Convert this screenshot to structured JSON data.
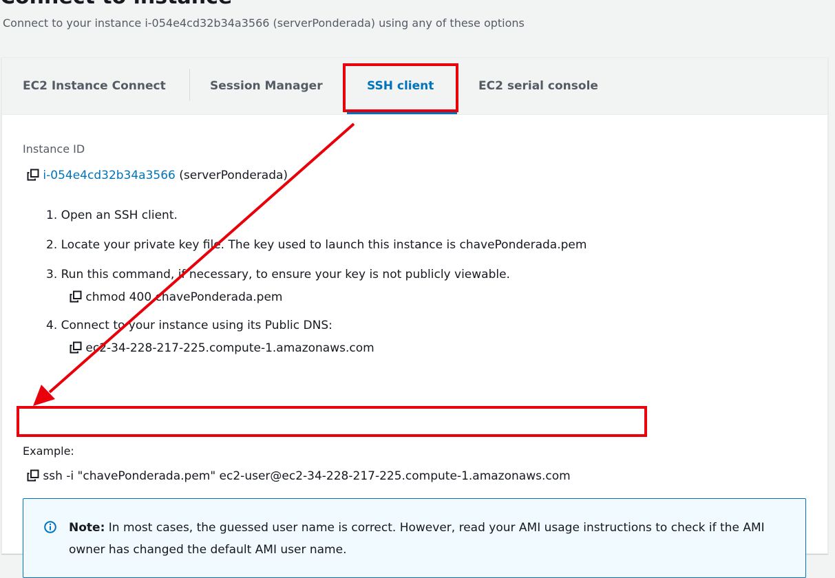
{
  "header": {
    "title": "Connect to instance",
    "subtitle": "Connect to your instance i-054e4cd32b34a3566 (serverPonderada) using any of these options"
  },
  "tabs": [
    {
      "label": "EC2 Instance Connect"
    },
    {
      "label": "Session Manager"
    },
    {
      "label": "SSH client"
    },
    {
      "label": "EC2 serial console"
    }
  ],
  "instance": {
    "label": "Instance ID",
    "id": "i-054e4cd32b34a3566",
    "name": "(serverPonderada)"
  },
  "steps": [
    {
      "text": "1. Open an SSH client."
    },
    {
      "text": "2. Locate your private key file. The key used to launch this instance is chavePonderada.pem"
    },
    {
      "text": "3. Run this command, if necessary, to ensure your key is not publicly viewable.",
      "command": "chmod 400 chavePonderada.pem"
    },
    {
      "text": "4. Connect to your instance using its Public DNS:",
      "command": "ec2-34-228-217-225.compute-1.amazonaws.com"
    }
  ],
  "example": {
    "label": "Example:",
    "command": "ssh -i \"chavePonderada.pem\" ec2-user@ec2-34-228-217-225.compute-1.amazonaws.com"
  },
  "note": {
    "title": "Note:",
    "text": " In most cases, the guessed user name is correct. However, read your AMI usage instructions to check if the AMI owner has changed the default AMI user name."
  },
  "colors": {
    "accent": "#0073bb",
    "annotation": "#e8000b"
  },
  "icons": [
    "copy-icon",
    "info-icon"
  ]
}
